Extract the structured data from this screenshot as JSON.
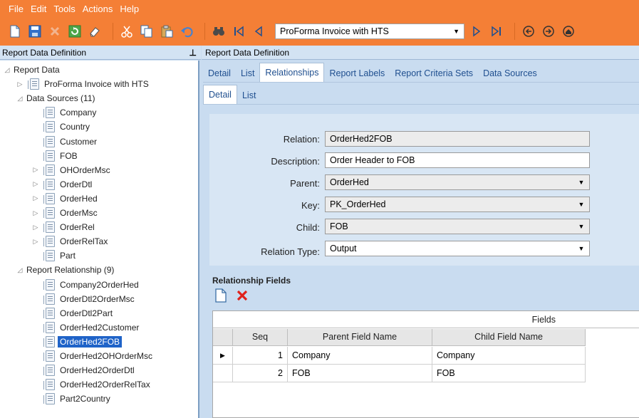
{
  "menu": [
    "File",
    "Edit",
    "Tools",
    "Actions",
    "Help"
  ],
  "toolbar": {
    "report_combo": "ProForma Invoice with HTS",
    "icons": [
      "new-icon",
      "save-icon",
      "delete-icon",
      "refresh-icon",
      "clear-icon",
      "cut-icon",
      "copy-icon",
      "paste-icon",
      "undo-icon",
      "search-icon",
      "first-icon",
      "prev-icon",
      "next-icon",
      "last-icon",
      "back-icon",
      "forward-icon",
      "home-icon"
    ]
  },
  "left": {
    "header": "Report Data Definition",
    "pin": "ᵖ",
    "tree": [
      {
        "label": "Report Data",
        "level": 0,
        "expander": "◿",
        "icon": false
      },
      {
        "label": "ProForma Invoice with HTS",
        "level": 1,
        "expander": "▷",
        "icon": true
      },
      {
        "label": "Data Sources (11)",
        "level": 1,
        "expander": "◿",
        "icon": false
      },
      {
        "label": "Company",
        "level": 2,
        "expander": "",
        "icon": true
      },
      {
        "label": "Country",
        "level": 2,
        "expander": "",
        "icon": true
      },
      {
        "label": "Customer",
        "level": 2,
        "expander": "",
        "icon": true
      },
      {
        "label": "FOB",
        "level": 2,
        "expander": "",
        "icon": true
      },
      {
        "label": "OHOrderMsc",
        "level": 2,
        "expander": "▷",
        "icon": true
      },
      {
        "label": "OrderDtl",
        "level": 2,
        "expander": "▷",
        "icon": true
      },
      {
        "label": "OrderHed",
        "level": 2,
        "expander": "▷",
        "icon": true
      },
      {
        "label": "OrderMsc",
        "level": 2,
        "expander": "▷",
        "icon": true
      },
      {
        "label": "OrderRel",
        "level": 2,
        "expander": "▷",
        "icon": true
      },
      {
        "label": "OrderRelTax",
        "level": 2,
        "expander": "▷",
        "icon": true
      },
      {
        "label": "Part",
        "level": 2,
        "expander": "",
        "icon": true
      },
      {
        "label": "Report Relationship (9)",
        "level": 1,
        "expander": "◿",
        "icon": false
      },
      {
        "label": "Company2OrderHed",
        "level": 2,
        "expander": "",
        "icon": true
      },
      {
        "label": "OrderDtl2OrderMsc",
        "level": 2,
        "expander": "",
        "icon": true
      },
      {
        "label": "OrderDtl2Part",
        "level": 2,
        "expander": "",
        "icon": true
      },
      {
        "label": "OrderHed2Customer",
        "level": 2,
        "expander": "",
        "icon": true
      },
      {
        "label": "OrderHed2FOB",
        "level": 2,
        "expander": "",
        "icon": true,
        "selected": true
      },
      {
        "label": "OrderHed2OHOrderMsc",
        "level": 2,
        "expander": "",
        "icon": true
      },
      {
        "label": "OrderHed2OrderDtl",
        "level": 2,
        "expander": "",
        "icon": true
      },
      {
        "label": "OrderHed2OrderRelTax",
        "level": 2,
        "expander": "",
        "icon": true
      },
      {
        "label": "Part2Country",
        "level": 2,
        "expander": "",
        "icon": true
      }
    ]
  },
  "right": {
    "header": "Report Data Definition",
    "tabs": [
      "Detail",
      "List",
      "Relationships",
      "Report Labels",
      "Report Criteria Sets",
      "Data Sources"
    ],
    "active_tab": "Relationships",
    "subtabs": [
      "Detail",
      "List"
    ],
    "active_subtab": "Detail",
    "form": {
      "relation_label": "Relation:",
      "relation_value": "OrderHed2FOB",
      "description_label": "Description:",
      "description_value": "Order Header to FOB",
      "parent_label": "Parent:",
      "parent_value": "OrderHed",
      "key_label": "Key:",
      "key_value": "PK_OrderHed",
      "child_label": "Child:",
      "child_value": "FOB",
      "relation_type_label": "Relation Type:",
      "relation_type_value": "Output"
    },
    "relationship_fields": {
      "title": "Relationship Fields",
      "group_header": "Fields",
      "columns": [
        "Seq",
        "Parent Field Name",
        "Child Field Name"
      ],
      "rows": [
        {
          "seq": "1",
          "parent": "Company",
          "child": "Company",
          "current": true
        },
        {
          "seq": "2",
          "parent": "FOB",
          "child": "FOB",
          "current": false
        }
      ]
    }
  }
}
